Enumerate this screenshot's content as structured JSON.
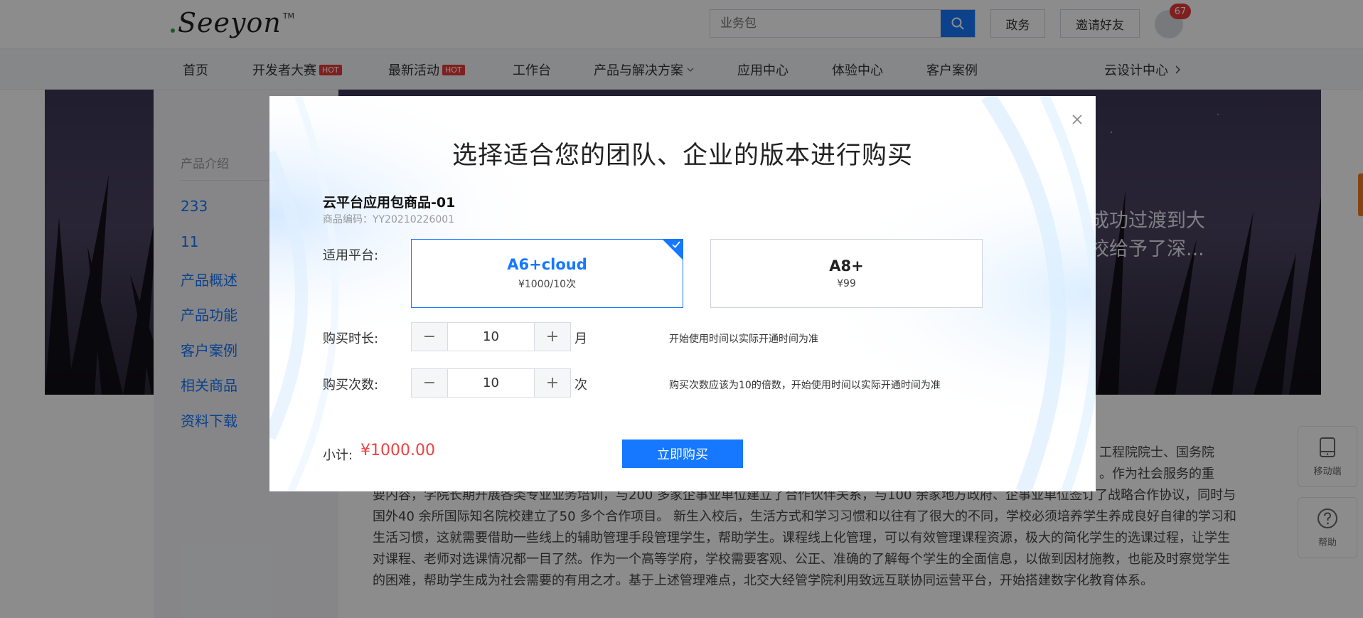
{
  "header": {
    "logo_text": "Seeyon",
    "logo_tm": "TM",
    "search_placeholder": "业务包",
    "btn_gov": "政务",
    "btn_invite": "邀请好友",
    "notification_count": "67"
  },
  "nav": {
    "items": [
      {
        "label": "首页"
      },
      {
        "label": "开发者大赛",
        "badge": "HOT"
      },
      {
        "label": "最新活动",
        "badge": "HOT"
      },
      {
        "label": "工作台"
      },
      {
        "label": "产品与解决方案"
      },
      {
        "label": "应用中心"
      },
      {
        "label": "体验中心"
      },
      {
        "label": "客户案例"
      }
    ],
    "right_label": "云设计中心"
  },
  "hero": {
    "text_line1": "成功过渡到大",
    "text_line2": "校给予了深..."
  },
  "sidebar": {
    "title": "产品介绍",
    "items": [
      "233",
      "11",
      "产品概述",
      "产品功能",
      "客户案例",
      "相关商品",
      "资料下载"
    ]
  },
  "article": {
    "line_right1": "工程院院士、国务院",
    "line_right2": "。作为社会服务的重",
    "line3": "要内容，学院长期开展各类专业业务培训，与200 多家企事业单位建立了合作伙伴关系，与100 余家地方政府、企事业单位签订了战略合作协议，同时与",
    "line4": "国外40 余所国际知名院校建立了50 多个合作项目。 新生入校后，生活方式和学习习惯和以往有了很大的不同，学校必须培养学生养成良好自律的学习和",
    "line5": "生活习惯，这就需要借助一些线上的辅助管理手段管理学生，帮助学生。课程线上化管理，可以有效管理课程资源，极大的简化学生的选课过程，让学生",
    "line6": "对课程、老师对选课情况都一目了然。作为一个高等学府，学校需要客观、公正、准确的了解每个学生的全面信息，以做到因材施教，也能及时察觉学生",
    "line7": "的困难，帮助学生成为社会需要的有用之才。基于上述管理难点，北交大经管学院利用致远互联协同运营平台，开始搭建数字化教育体系。"
  },
  "float": {
    "mobile_label": "移动端",
    "help_label": "帮助"
  },
  "modal": {
    "title": "选择适合您的团队、企业的版本进行购买",
    "product_name": "云平台应用包商品-01",
    "product_code": "商品编码：YY20210226001",
    "platform_label": "适用平台:",
    "platforms": [
      {
        "name": "A6+cloud",
        "price": "¥1000/10次",
        "selected": true
      },
      {
        "name": "A8+",
        "price": "¥99",
        "selected": false
      }
    ],
    "duration_label": "购买时长:",
    "duration_value": "10",
    "duration_unit": "月",
    "duration_hint": "开始使用时间以实际开通时间为准",
    "count_label": "购买次数:",
    "count_value": "10",
    "count_unit": "次",
    "count_hint": "购买次数应该为10的倍数，开始使用时间以实际开通时间为准",
    "subtotal_label": "小计:",
    "subtotal_value": "¥1000.00",
    "buy_label": "立即购买",
    "minus": "−",
    "plus": "+"
  },
  "colors": {
    "primary": "#1677ff",
    "price_red": "#f04141",
    "hot_badge": "#e83a3a"
  }
}
